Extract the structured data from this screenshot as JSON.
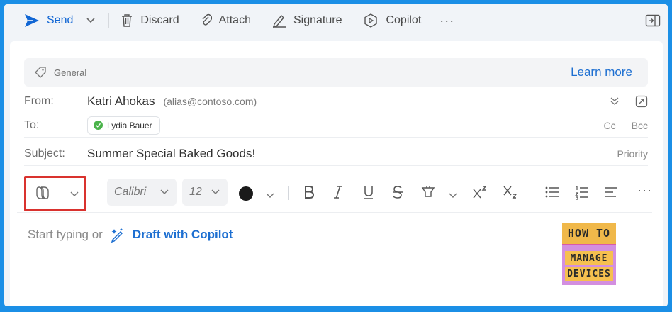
{
  "toolbar": {
    "send": "Send",
    "discard": "Discard",
    "attach": "Attach",
    "signature": "Signature",
    "copilot": "Copilot",
    "more": "···"
  },
  "sensitivity": {
    "label": "General",
    "learn_more": "Learn more"
  },
  "header": {
    "from_label": "From:",
    "from_name": "Katri Ahokas",
    "from_alias": "(alias@contoso.com)",
    "to_label": "To:",
    "recipient": "Lydia Bauer",
    "cc": "Cc",
    "bcc": "Bcc",
    "subject_label": "Subject:",
    "subject": "Summer Special Baked Goods!",
    "priority": "Priority"
  },
  "format": {
    "font": "Calibri",
    "size": "12",
    "more": "···"
  },
  "body": {
    "start": "Start typing or",
    "draft": "Draft with Copilot"
  },
  "logo": {
    "line1": "HOW TO",
    "line2": "MANAGE",
    "line3": "DEVICES"
  },
  "colors": {
    "accent": "#1d6fd1",
    "highlight": "#d9322e",
    "frame": "#1b8fe6"
  }
}
